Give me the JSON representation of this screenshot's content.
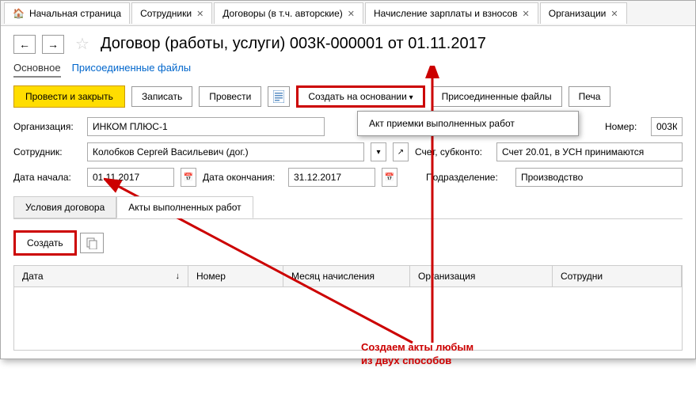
{
  "tabs": [
    "Начальная страница",
    "Сотрудники",
    "Договоры (в т.ч. авторские)",
    "Начисление зарплаты и взносов",
    "Организации"
  ],
  "page_title": "Договор (работы, услуги) 003К-000001 от 01.11.2017",
  "subnav": {
    "main": "Основное",
    "files": "Присоединенные файлы"
  },
  "toolbar": {
    "post_close": "Провести и закрыть",
    "save": "Записать",
    "post": "Провести",
    "create_based": "Создать на основании",
    "attached": "Присоединенные файлы",
    "print": "Печа"
  },
  "dropdown_item": "Акт приемки выполненных работ",
  "form": {
    "org_label": "Организация:",
    "org_value": "ИНКОМ ПЛЮС-1",
    "number_label": "Номер:",
    "number_value": "003К",
    "employee_label": "Сотрудник:",
    "employee_value": "Колобков Сергей Васильевич (дог.)",
    "account_label": "Счет, субконто:",
    "account_value": "Счет 20.01, в УСН принимаются",
    "start_label": "Дата начала:",
    "start_value": "01.11.2017",
    "end_label": "Дата окончания:",
    "end_value": "31.12.2017",
    "division_label": "Подразделение:",
    "division_value": "Производство"
  },
  "sub_tabs": {
    "conditions": "Условия договора",
    "acts": "Акты выполненных работ"
  },
  "create_btn": "Создать",
  "table_headers": {
    "date": "Дата",
    "number": "Номер",
    "month": "Месяц начисления",
    "org": "Организация",
    "employee": "Сотрудни"
  },
  "annotation": {
    "line1": "Создаем акты любым",
    "line2": "из двух способов"
  }
}
